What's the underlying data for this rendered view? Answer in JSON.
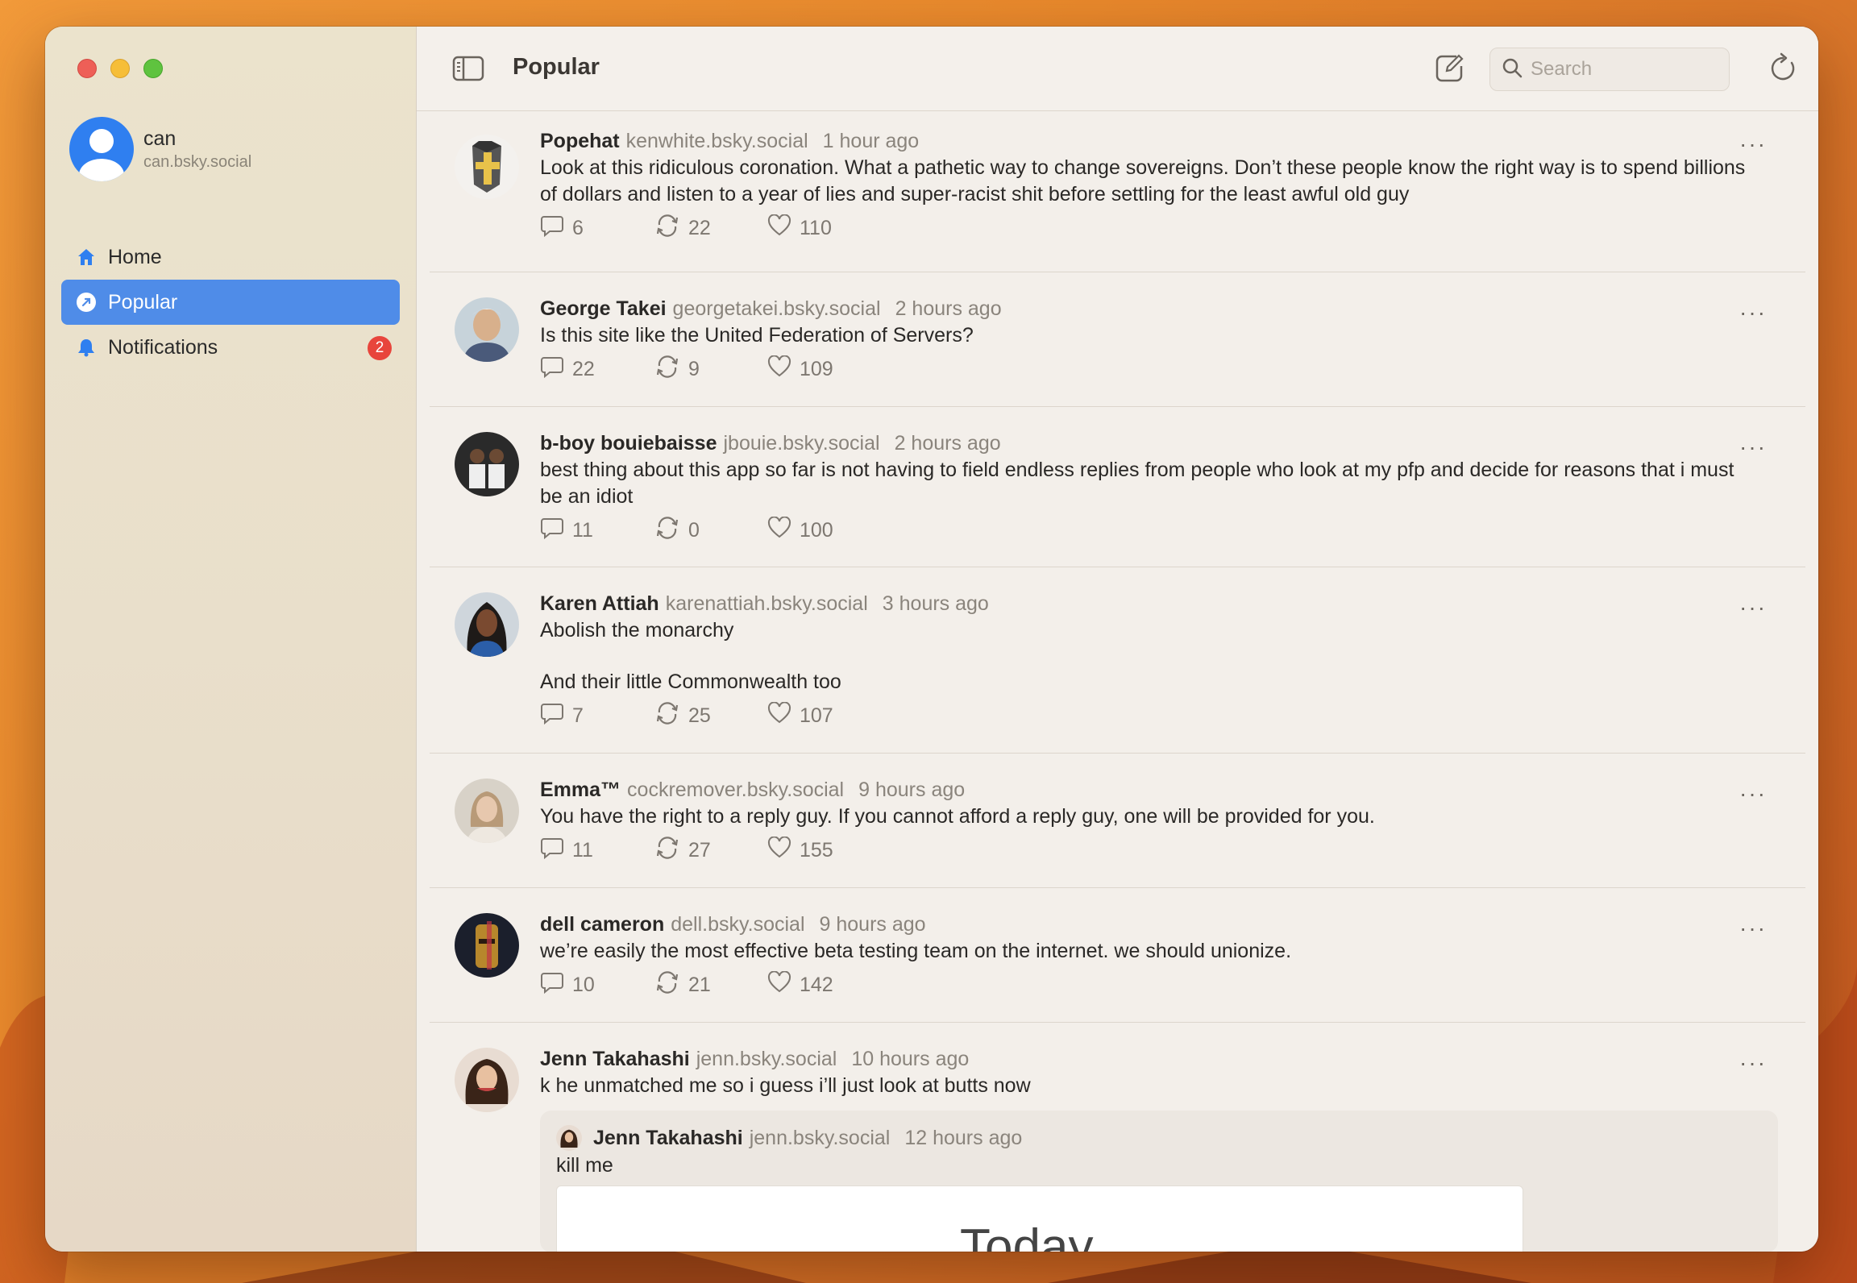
{
  "sidebar": {
    "profile": {
      "name": "can",
      "handle": "can.bsky.social"
    },
    "items": [
      {
        "label": "Home",
        "icon": "house-icon"
      },
      {
        "label": "Popular",
        "icon": "trending-icon",
        "active": true
      },
      {
        "label": "Notifications",
        "icon": "bell-icon",
        "badge": "2"
      }
    ]
  },
  "toolbar": {
    "title": "Popular",
    "search_placeholder": "Search"
  },
  "posts": [
    {
      "name": "Popehat",
      "handle": "kenwhite.bsky.social",
      "time": "1 hour ago",
      "text": [
        "Look at this ridiculous coronation. What a pathetic way to change sovereigns. Don’t these people know the right way is to spend billions of dollars and listen to a year of lies and super-racist shit before settling for the least awful old guy"
      ],
      "replies": "6",
      "reposts": "22",
      "likes": "110"
    },
    {
      "name": "George Takei",
      "handle": "georgetakei.bsky.social",
      "time": "2 hours ago",
      "text": [
        "Is this site like the United Federation of Servers?"
      ],
      "replies": "22",
      "reposts": "9",
      "likes": "109"
    },
    {
      "name": "b-boy bouiebaisse",
      "handle": "jbouie.bsky.social",
      "time": "2 hours ago",
      "text": [
        "best thing about this app so far is not having to field endless replies from people who look at my pfp and decide for reasons that i must be an idiot"
      ],
      "replies": "11",
      "reposts": "0",
      "likes": "100"
    },
    {
      "name": "Karen Attiah",
      "handle": "karenattiah.bsky.social",
      "time": "3 hours ago",
      "text": [
        "Abolish the monarchy",
        "And their little Commonwealth too"
      ],
      "replies": "7",
      "reposts": "25",
      "likes": "107"
    },
    {
      "name": "Emma™",
      "handle": "cockremover.bsky.social",
      "time": "9 hours ago",
      "text": [
        "You have the right to a reply guy. If you cannot afford a reply guy, one will be provided for you."
      ],
      "replies": "11",
      "reposts": "27",
      "likes": "155"
    },
    {
      "name": "dell cameron",
      "handle": "dell.bsky.social",
      "time": "9 hours ago",
      "text": [
        "we’re easily the most effective beta testing team on the internet. we should unionize."
      ],
      "replies": "10",
      "reposts": "21",
      "likes": "142"
    },
    {
      "name": "Jenn Takahashi",
      "handle": "jenn.bsky.social",
      "time": "10 hours ago",
      "text": [
        "k he unmatched me so i guess i’ll just look at butts now"
      ],
      "quote": {
        "name": "Jenn Takahashi",
        "handle": "jenn.bsky.social",
        "time": "12 hours ago",
        "text": "kill me",
        "image_text": "Today"
      }
    }
  ]
}
